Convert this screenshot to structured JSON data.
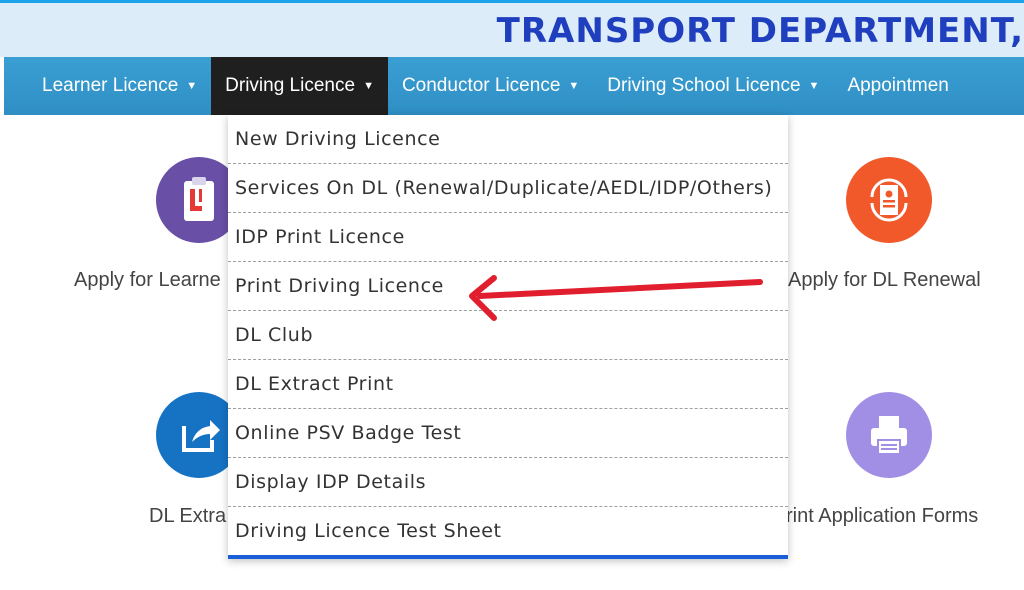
{
  "header": {
    "title": "TRANSPORT DEPARTMENT,"
  },
  "nav": {
    "items": [
      {
        "label": "Learner Licence",
        "caret": "▼"
      },
      {
        "label": "Driving Licence",
        "caret": "▼"
      },
      {
        "label": "Conductor Licence",
        "caret": "▼"
      },
      {
        "label": "Driving School Licence",
        "caret": "▼"
      },
      {
        "label": "Appointmen"
      }
    ]
  },
  "dropdown": {
    "items": [
      "New Driving Licence",
      "Services On DL (Renewal/Duplicate/AEDL/IDP/Others)",
      "IDP Print Licence",
      "Print Driving Licence",
      "DL Club",
      "DL Extract Print",
      "Online PSV Badge Test",
      "Display IDP Details",
      "Driving Licence Test Sheet"
    ]
  },
  "cards": {
    "learner": {
      "label": "Apply for Learne",
      "icon": "clipboard-l-icon",
      "color": "#6a4fa6"
    },
    "renewal": {
      "label": "Apply for DL Renewal",
      "icon": "renewal-document-icon",
      "color": "#f2592a"
    },
    "extract": {
      "label": "DL Extra",
      "icon": "share-icon",
      "color": "#1673c4"
    },
    "forms": {
      "label": "rint Application Forms",
      "icon": "printer-icon",
      "color": "#a18fe6"
    }
  },
  "annotation": {
    "color": "#e01e2e"
  }
}
